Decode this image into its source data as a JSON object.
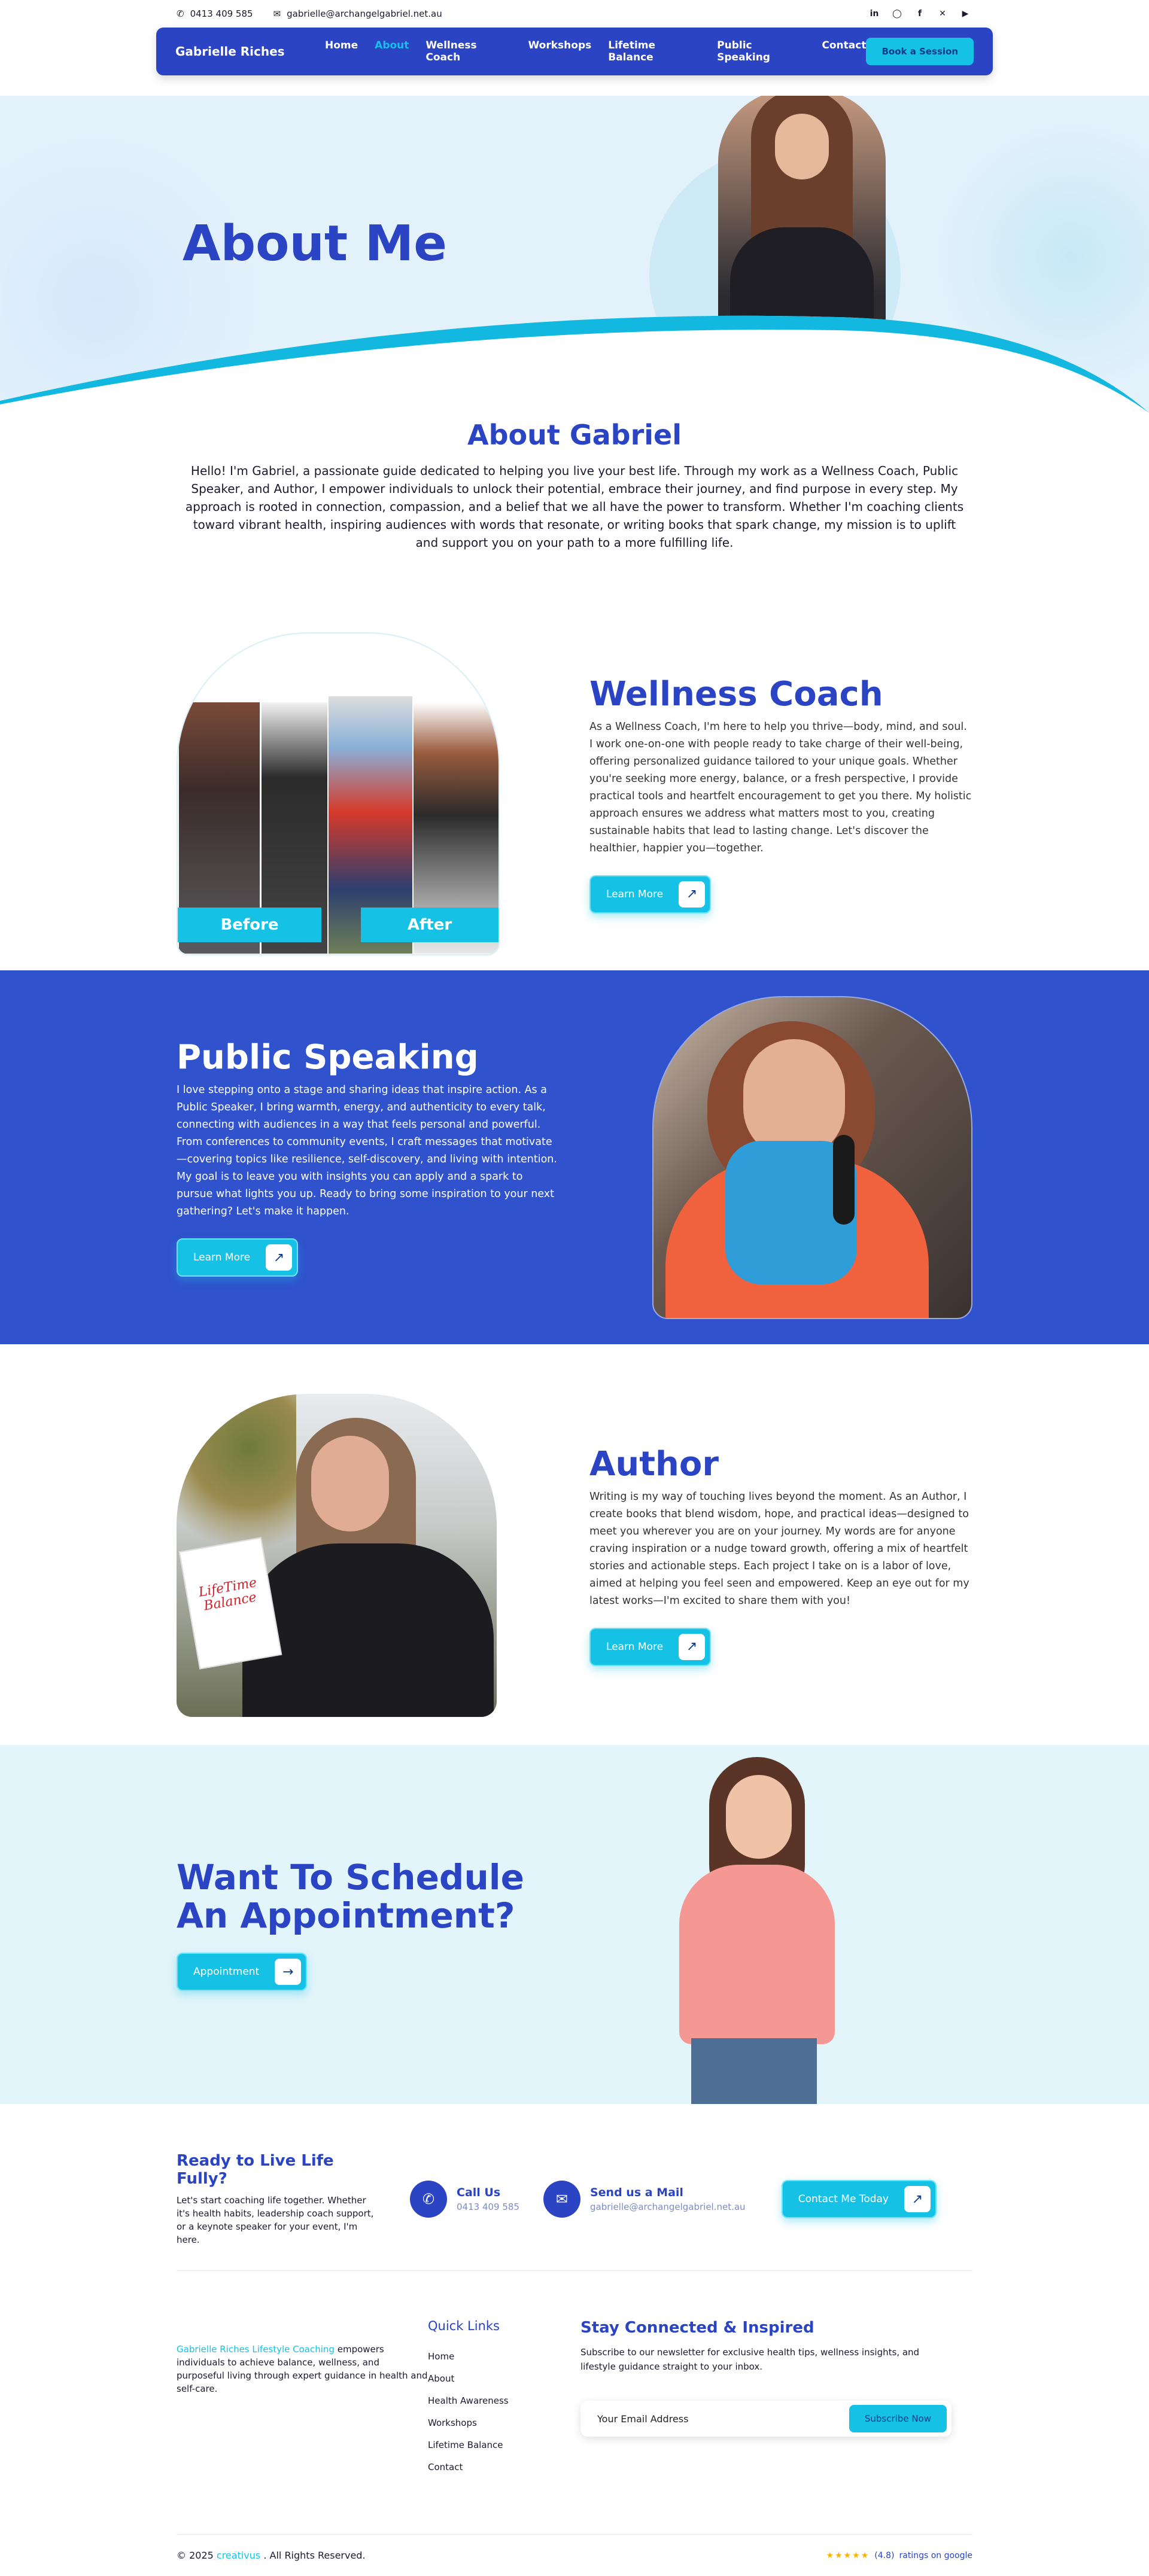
{
  "topbar": {
    "phone": "0413 409 585",
    "email": "gabrielle@archangelgabriel.net.au",
    "socials": [
      "linkedin-icon",
      "instagram-icon",
      "facebook-icon",
      "x-icon",
      "youtube-icon"
    ]
  },
  "nav": {
    "brand": "Gabrielle Riches",
    "items": [
      {
        "label": "Home"
      },
      {
        "label": "About"
      },
      {
        "label": "Wellness Coach"
      },
      {
        "label": "Workshops"
      },
      {
        "label": "Lifetime Balance"
      },
      {
        "label": "Public Speaking"
      },
      {
        "label": "Contact"
      }
    ],
    "active": "About",
    "cta": "Book a Session"
  },
  "hero": {
    "title": "About Me"
  },
  "about": {
    "title": "About Gabriel",
    "text": "Hello! I'm Gabriel, a passionate guide dedicated to helping you live your best life. Through my work as a Wellness Coach, Public Speaker, and Author, I empower individuals to unlock their potential, embrace their journey, and find purpose in every step. My approach is rooted in connection, compassion, and a belief that we all have the power to transform. Whether I'm coaching clients toward vibrant health, inspiring audiences with words that resonate, or writing books that spark change, my mission is to uplift and support you on your path to a more fulfilling life."
  },
  "wellness": {
    "title": "Wellness Coach",
    "text": "As a Wellness Coach, I'm here to help you thrive—body, mind, and soul. I work one-on-one with people ready to take charge of their well-being, offering personalized guidance tailored to your unique goals. Whether you're seeking more energy, balance, or a fresh perspective, I provide practical tools and heartfelt encouragement to get you there. My holistic approach ensures we address what matters most to you, creating sustainable habits that lead to lasting change. Let's discover the healthier, happier you—together.",
    "button": "Learn More",
    "before_label": "Before",
    "after_label": "After"
  },
  "public_speaking": {
    "title": "Public Speaking",
    "text": "I love stepping onto a stage and sharing ideas that inspire action. As a Public Speaker, I bring warmth, energy, and authenticity to every talk, connecting with audiences in a way that feels personal and powerful. From conferences to community events, I craft messages that motivate—covering topics like resilience, self-discovery, and living with intention. My goal is to leave you with insights you can apply and a spark to pursue what lights you up. Ready to bring some inspiration to your next gathering? Let's make it happen.",
    "button": "Learn More"
  },
  "author": {
    "title": "Author",
    "text": "Writing is my way of touching lives beyond the moment. As an Author, I create books that blend wisdom, hope, and practical ideas—designed to meet you wherever you are on your journey. My words are for anyone craving inspiration or a nudge toward growth, offering a mix of heartfelt stories and actionable steps. Each project I take on is a labor of love, aimed at helping you feel seen and empowered. Keep an eye out for my latest works—I'm excited to share them with you!",
    "button": "Learn More",
    "book_title_line1": "LifeTime",
    "book_title_line2": "Balance"
  },
  "appointment": {
    "title": "Want To Schedule An Appointment?",
    "button": "Appointment"
  },
  "cta": {
    "title": "Ready to Live Life Fully?",
    "text": "Let's start coaching life together. Whether it's health habits, leadership coach support, or a keynote speaker for your event, I'm here.",
    "call_title": "Call Us",
    "call_value": "0413 409 585",
    "mail_title": "Send us a Mail",
    "mail_value": "gabrielle@archangelgabriel.net.au",
    "button": "Contact Me Today"
  },
  "footer": {
    "about_link": "Gabrielle Riches Lifestyle Coaching",
    "about_text": "empowers individuals to achieve balance, wellness, and purposeful living through expert guidance in health and self-care.",
    "links_title": "Quick Links",
    "links": [
      {
        "label": "Home"
      },
      {
        "label": "About"
      },
      {
        "label": "Health Awareness"
      },
      {
        "label": "Workshops"
      },
      {
        "label": "Lifetime Balance"
      },
      {
        "label": "Contact"
      }
    ],
    "newsletter_title": "Stay Connected & Inspired",
    "newsletter_text": "Subscribe to our newsletter for exclusive health tips, wellness insights, and lifestyle guidance straight to your inbox.",
    "newsletter_placeholder": "Your Email Address",
    "newsletter_button": "Subscribe Now",
    "copyright_prefix": "© 2025",
    "copyright_link": "creativus",
    "copyright_suffix": ". All Rights Reserved.",
    "rating_value": "(4.8)",
    "rating_text": "ratings on google",
    "rating_stars": 4.8
  },
  "colors": {
    "primary": "#2a44c4",
    "accent": "#15c2e6",
    "section_blue": "#3052cc",
    "light_bg": "#e2f5fa"
  }
}
